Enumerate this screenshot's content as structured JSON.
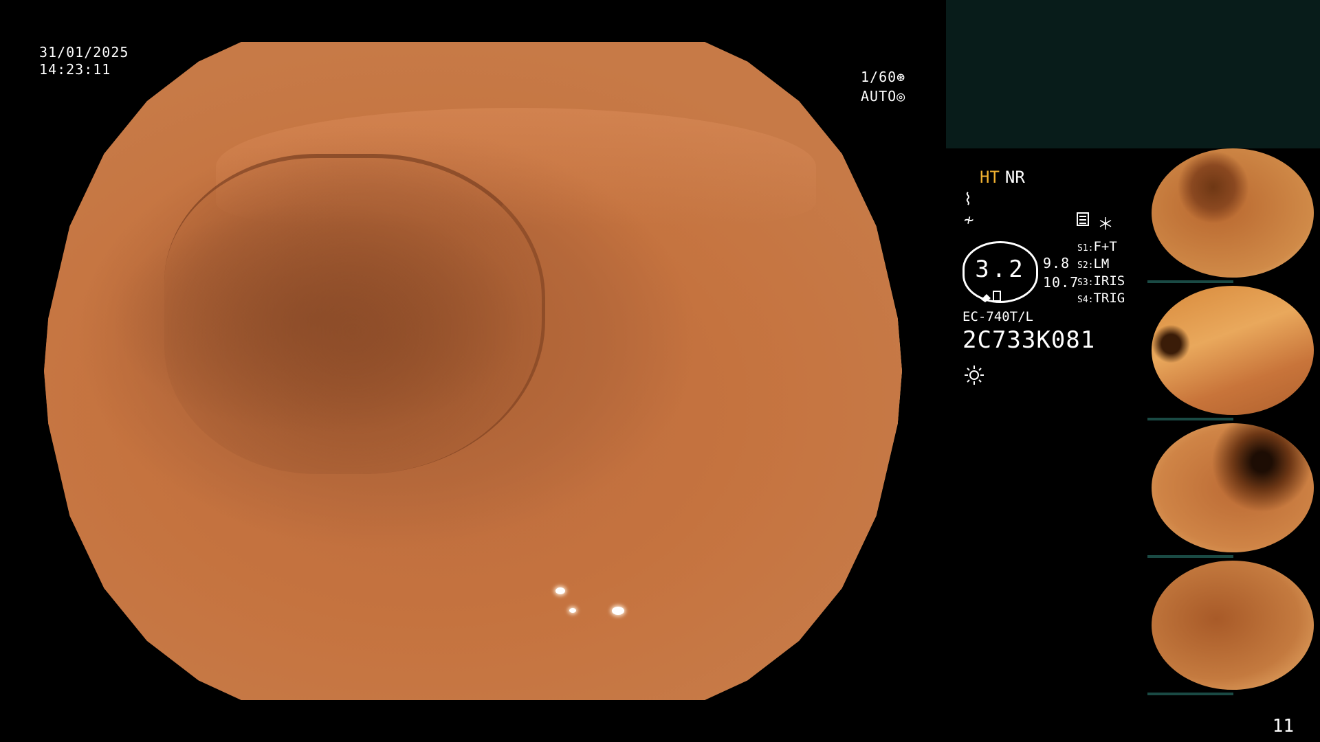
{
  "datetime": {
    "date": "31/01/2025",
    "time": "14:23:11"
  },
  "shutter": {
    "speed": "1/60",
    "mode": "AUTO"
  },
  "status": {
    "mode_ht": "HT",
    "mode_nr": "NR",
    "glyph_1": "⌇",
    "glyph_2": "≁",
    "gauge_value": "3.2",
    "value_top": "9.8",
    "value_bottom": "10.7",
    "freeze_marker": "＊"
  },
  "scope": {
    "model": "EC-740T/L",
    "serial": "2C733K081"
  },
  "switches": [
    {
      "key": "S1:",
      "value": "F+T"
    },
    {
      "key": "S2:",
      "value": "LM"
    },
    {
      "key": "S3:",
      "value": "IRIS"
    },
    {
      "key": "S4:",
      "value": "TRIG"
    }
  ],
  "page_number": "11",
  "colors": {
    "mucosa": "#c5733f",
    "mode_ht": "#f2b230",
    "panel": "#081c1a"
  }
}
